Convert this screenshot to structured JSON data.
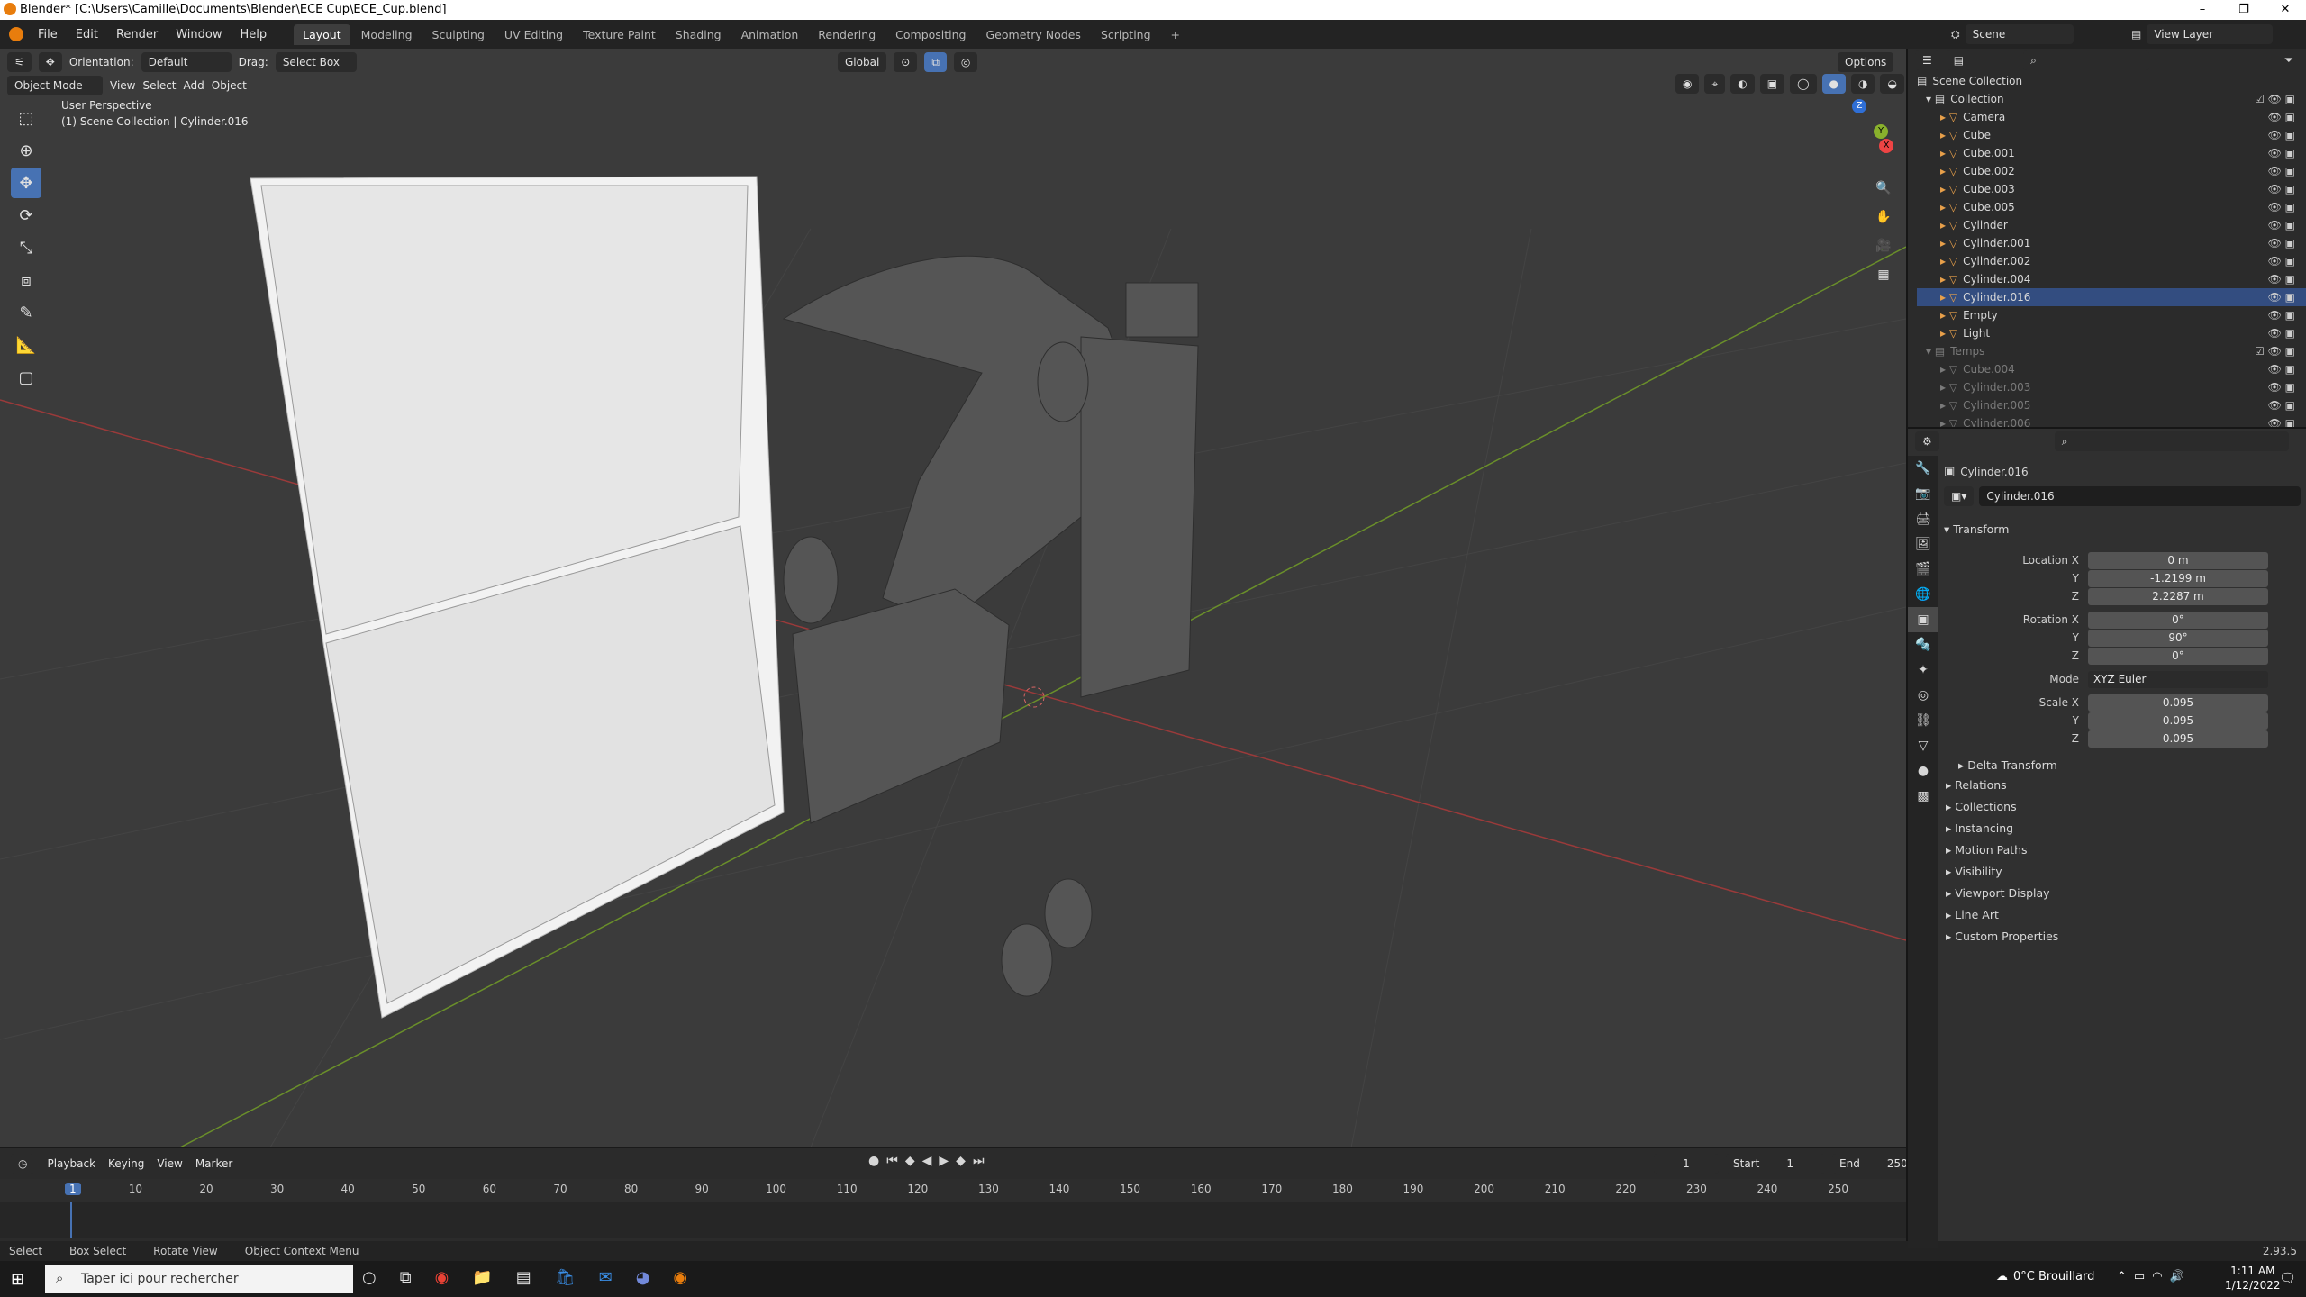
{
  "window": {
    "title": "Blender* [C:\\Users\\Camille\\Documents\\Blender\\ECE Cup\\ECE_Cup.blend]",
    "minimize": "–",
    "maximize": "❐",
    "close": "✕"
  },
  "menu": {
    "items": [
      "File",
      "Edit",
      "Render",
      "Window",
      "Help"
    ],
    "workspaces": [
      "Layout",
      "Modeling",
      "Sculpting",
      "UV Editing",
      "Texture Paint",
      "Shading",
      "Animation",
      "Rendering",
      "Compositing",
      "Geometry Nodes",
      "Scripting"
    ],
    "active_workspace": "Layout",
    "add_workspace": "+",
    "scene": "Scene",
    "view_layer": "View Layer"
  },
  "viewport": {
    "orientation_label": "Orientation:",
    "orientation_value": "Default",
    "drag_label": "Drag:",
    "drag_value": "Select Box",
    "transform_space": "Global",
    "options": "Options",
    "mode": "Object Mode",
    "menus": [
      "View",
      "Select",
      "Add",
      "Object"
    ],
    "perspective": "User Perspective",
    "context": "(1) Scene Collection | Cylinder.016",
    "gizmo": {
      "x": "X",
      "y": "Y",
      "z": "Z"
    }
  },
  "timeline": {
    "menus": [
      "Playback",
      "Keying",
      "View",
      "Marker"
    ],
    "current_frame": "1",
    "start_label": "Start",
    "start": "1",
    "end_label": "End",
    "end": "250",
    "ticks": [
      "1",
      "10",
      "20",
      "30",
      "40",
      "50",
      "60",
      "70",
      "80",
      "90",
      "100",
      "110",
      "120",
      "130",
      "140",
      "150",
      "160",
      "170",
      "180",
      "190",
      "200",
      "210",
      "220",
      "230",
      "240",
      "250"
    ]
  },
  "statusbar": {
    "items": [
      "Select",
      "Box Select",
      "Rotate View",
      "Object Context Menu"
    ],
    "version": "2.93.5"
  },
  "outliner": {
    "root": "Scene Collection",
    "collection": "Collection",
    "items": [
      {
        "name": "Camera",
        "icon": "camera-icon",
        "color": "#e8a04a"
      },
      {
        "name": "Cube",
        "icon": "mesh-icon",
        "color": "#e8a04a"
      },
      {
        "name": "Cube.001",
        "icon": "mesh-icon",
        "color": "#e8a04a"
      },
      {
        "name": "Cube.002",
        "icon": "mesh-icon",
        "color": "#e8a04a"
      },
      {
        "name": "Cube.003",
        "icon": "mesh-icon",
        "color": "#e8a04a"
      },
      {
        "name": "Cube.005",
        "icon": "mesh-icon",
        "color": "#e8a04a"
      },
      {
        "name": "Cylinder",
        "icon": "mesh-icon",
        "color": "#e8a04a"
      },
      {
        "name": "Cylinder.001",
        "icon": "mesh-icon",
        "color": "#e8a04a"
      },
      {
        "name": "Cylinder.002",
        "icon": "mesh-icon",
        "color": "#e8a04a"
      },
      {
        "name": "Cylinder.004",
        "icon": "mesh-icon",
        "color": "#e8a04a"
      },
      {
        "name": "Cylinder.016",
        "icon": "mesh-icon",
        "color": "#e8a04a"
      },
      {
        "name": "Empty",
        "icon": "empty-icon",
        "color": "#e8a04a"
      },
      {
        "name": "Light",
        "icon": "light-icon",
        "color": "#e8a04a"
      }
    ],
    "temps_collection": "Temps",
    "temps": [
      "Cube.004",
      "Cylinder.003",
      "Cylinder.005",
      "Cylinder.006"
    ]
  },
  "properties": {
    "object_name": "Cylinder.016",
    "data_name": "Cylinder.016",
    "transform_label": "Transform",
    "location": {
      "label_x": "Location X",
      "label_y": "Y",
      "label_z": "Z",
      "x": "0 m",
      "y": "-1.2199 m",
      "z": "2.2287 m"
    },
    "rotation": {
      "label_x": "Rotation X",
      "label_y": "Y",
      "label_z": "Z",
      "x": "0°",
      "y": "90°",
      "z": "0°"
    },
    "mode_label": "Mode",
    "mode_value": "XYZ Euler",
    "scale": {
      "label_x": "Scale X",
      "label_y": "Y",
      "label_z": "Z",
      "x": "0.095",
      "y": "0.095",
      "z": "0.095"
    },
    "delta_transform": "Delta Transform",
    "panels": [
      "Relations",
      "Collections",
      "Instancing",
      "Motion Paths",
      "Visibility",
      "Viewport Display",
      "Line Art",
      "Custom Properties"
    ]
  },
  "taskbar": {
    "search_placeholder": "Taper ici pour rechercher",
    "weather": "0°C Brouillard",
    "time": "1:11 AM",
    "date": "1/12/2022"
  }
}
